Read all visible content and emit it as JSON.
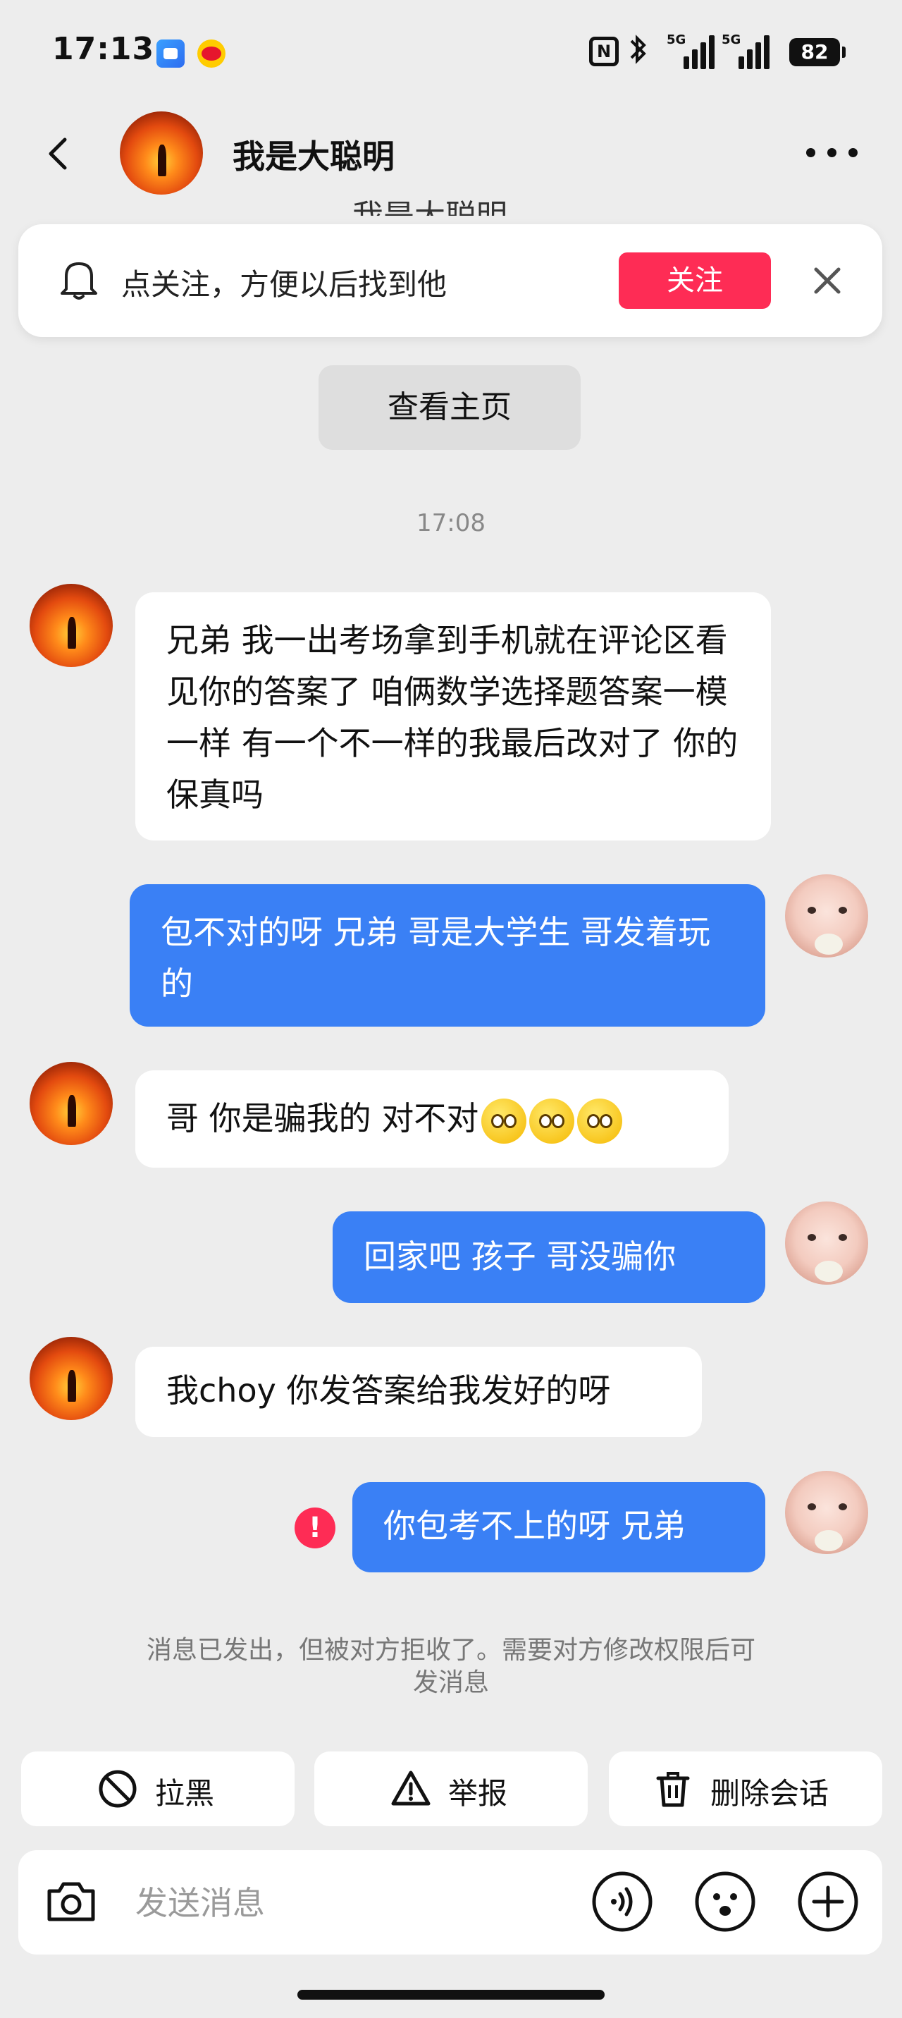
{
  "status_bar": {
    "time": "17:13",
    "network1": "5G",
    "network2": "5G",
    "battery": "82"
  },
  "header": {
    "title": "我是大聪明"
  },
  "ghost_title": "我是大聪明",
  "follow_banner": {
    "text": "点关注，方便以后找到他",
    "button": "关注"
  },
  "view_home": "查看主页",
  "timestamp": "17:08",
  "messages": [
    {
      "side": "in",
      "text": "兄弟 我一出考场拿到手机就在评论区看见你的答案了 咱俩数学选择题答案一模一样 有一个不一样的我最后改对了 你的保真吗"
    },
    {
      "side": "out",
      "text": "包不对的呀 兄弟 哥是大学生 哥发着玩的"
    },
    {
      "side": "in",
      "text": "哥 你是骗我的 对不对"
    },
    {
      "side": "out",
      "text": "回家吧 孩子 哥没骗你"
    },
    {
      "side": "in",
      "text": "我choy 你发答案给我发好的呀"
    },
    {
      "side": "out",
      "text": "你包考不上的呀 兄弟",
      "error": true
    }
  ],
  "reject_notice": "消息已发出，但被对方拒收了。需要对方修改权限后可发消息",
  "actions": {
    "block": "拉黑",
    "report": "举报",
    "delete": "删除会话"
  },
  "input": {
    "placeholder": "发送消息"
  },
  "colors": {
    "accent": "#fe2c55",
    "outgoing_bubble": "#3a80f5",
    "background": "#ededed"
  }
}
